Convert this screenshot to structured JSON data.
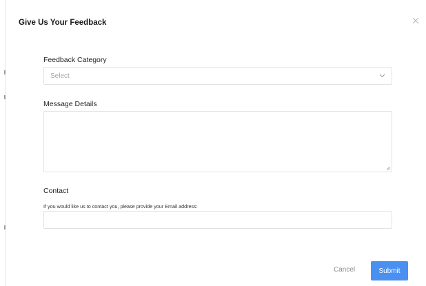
{
  "dialog": {
    "title": "Give Us Your Feedback"
  },
  "form": {
    "category": {
      "label": "Feedback Category",
      "value": "Select"
    },
    "message": {
      "label": "Message Details",
      "value": ""
    },
    "contact": {
      "label": "Contact",
      "help": "If you would like us to contact you, please provide your Email address:",
      "value": ""
    }
  },
  "actions": {
    "cancel_label": "Cancel",
    "submit_label": "Submit"
  },
  "icons": {
    "close": "close-icon",
    "dropdown": "chevron-down-icon",
    "resize": "resize-grip-icon"
  },
  "colors": {
    "primary": "#4a90f0",
    "border": "#e2e2e2",
    "placeholder": "#a6a6a6",
    "muted": "#8c8c8c"
  }
}
